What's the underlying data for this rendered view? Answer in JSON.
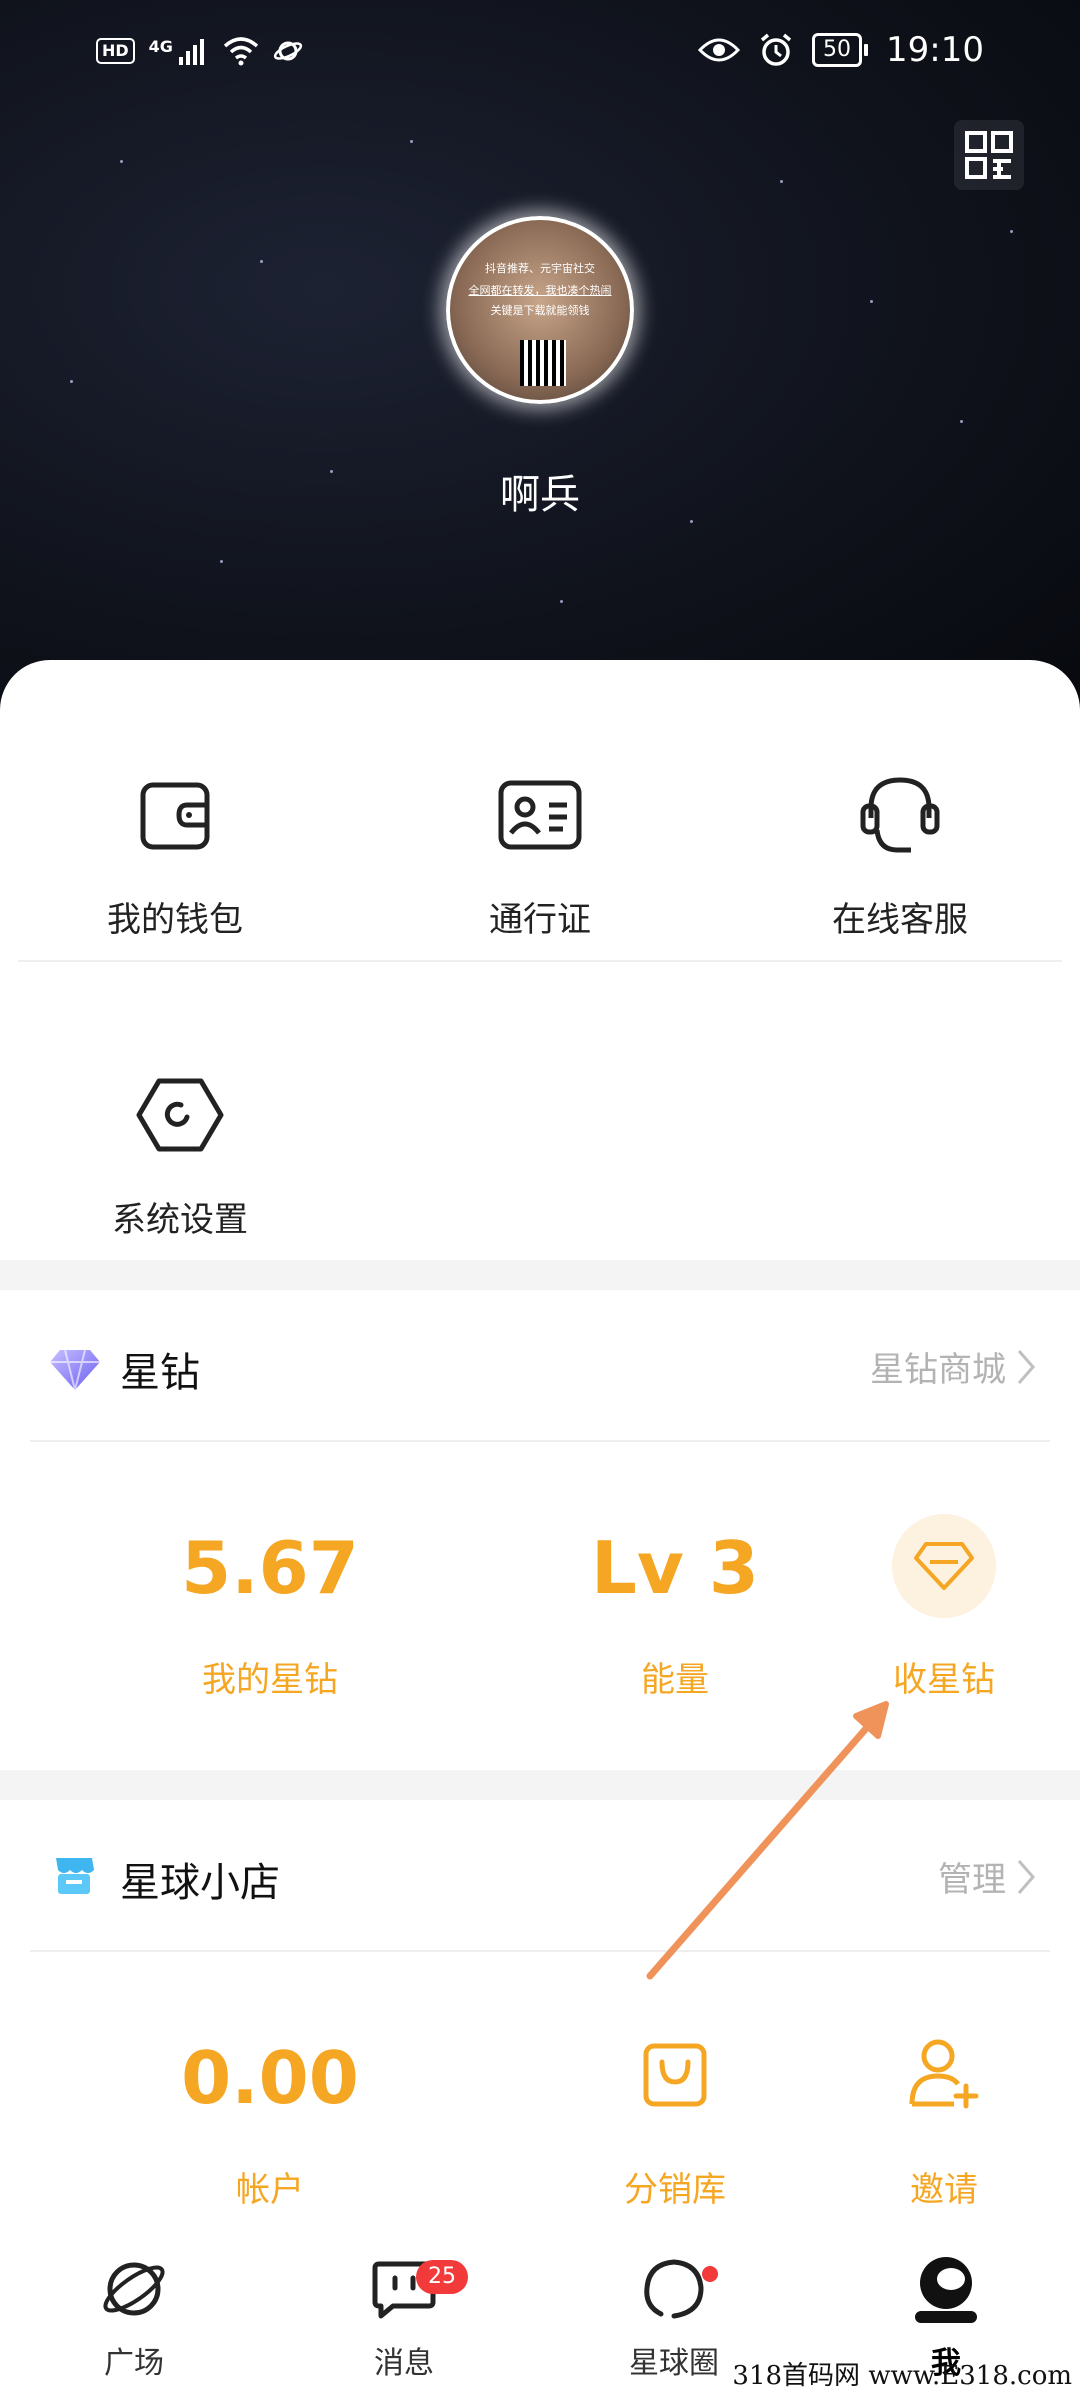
{
  "status_bar": {
    "hd": "HD",
    "network": "4G",
    "battery": "50",
    "time": "19:10"
  },
  "profile": {
    "name": "啊兵",
    "avatar_text": {
      "line1": "抖音推荐、元宇宙社交",
      "line2": "全网都在转发，我也凑个热闹",
      "line3": "关键是下载就能领钱"
    }
  },
  "grid": {
    "wallet": "我的钱包",
    "pass": "通行证",
    "service": "在线客服",
    "settings": "系统设置"
  },
  "stardiamond": {
    "title": "星钻",
    "link": "星钻商城",
    "value": "5.67",
    "value_label": "我的星钻",
    "level": "Lv 3",
    "level_label": "能量",
    "collect_label": "收星钻"
  },
  "shop": {
    "title": "星球小店",
    "link": "管理",
    "account": "0.00",
    "account_label": "帐户",
    "library_label": "分销库",
    "invite_label": "邀请"
  },
  "tabbar": {
    "plaza": "广场",
    "messages": "消息",
    "messages_badge": "25",
    "circle": "星球圈",
    "me": "我"
  },
  "watermark": "318首码网 www.E318.com",
  "colors": {
    "accent": "#f5a623",
    "badge": "#f23a3a",
    "arrow": "#f0935a"
  }
}
